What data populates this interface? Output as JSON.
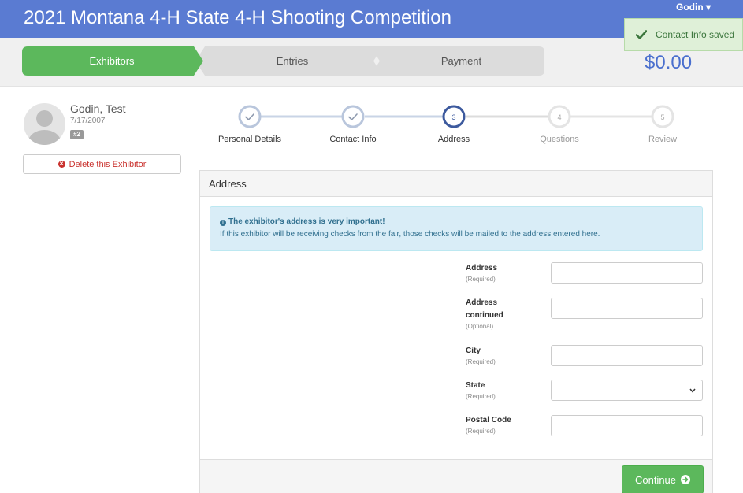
{
  "header": {
    "title": "2021 Montana 4-H State 4-H Shooting Competition",
    "user_label": "Godin ▾"
  },
  "toast": {
    "message": "Contact Info saved",
    "icon": "check-icon"
  },
  "progress": {
    "tabs": [
      {
        "label": "Exhibitors",
        "active": true
      },
      {
        "label": "Entries",
        "active": false
      },
      {
        "label": "Payment",
        "active": false
      }
    ],
    "total": "$0.00"
  },
  "exhibitor": {
    "name": "Godin, Test",
    "dob": "7/17/2007",
    "badge": "#2",
    "delete_label": "Delete this Exhibitor"
  },
  "steps": [
    {
      "number": "",
      "label": "Personal Details",
      "state": "done"
    },
    {
      "number": "",
      "label": "Contact Info",
      "state": "done"
    },
    {
      "number": "3",
      "label": "Address",
      "state": "current"
    },
    {
      "number": "4",
      "label": "Questions",
      "state": "todo"
    },
    {
      "number": "5",
      "label": "Review",
      "state": "todo"
    }
  ],
  "panel": {
    "title": "Address",
    "alert_title": "The exhibitor's address is very important!",
    "alert_text": "If this exhibitor will be receiving checks from the fair, those checks will be mailed to the address entered here.",
    "fields": [
      {
        "label": "Address",
        "sub": "(Required)",
        "value": ""
      },
      {
        "label": "Address continued",
        "sub": "(Optional)",
        "value": ""
      },
      {
        "label": "City",
        "sub": "(Required)",
        "value": ""
      },
      {
        "label": "State",
        "sub": "(Required)",
        "value": ""
      },
      {
        "label": "Postal Code",
        "sub": "(Required)",
        "value": ""
      }
    ],
    "continue_label": "Continue"
  },
  "colors": {
    "header_bg": "#5a7bd2",
    "active_tab": "#5cb85c",
    "inactive_tab": "#dcdcdc",
    "step_done": "#b9c6dc",
    "step_current": "#3d5a9e",
    "continue_button": "#5cb85c"
  }
}
